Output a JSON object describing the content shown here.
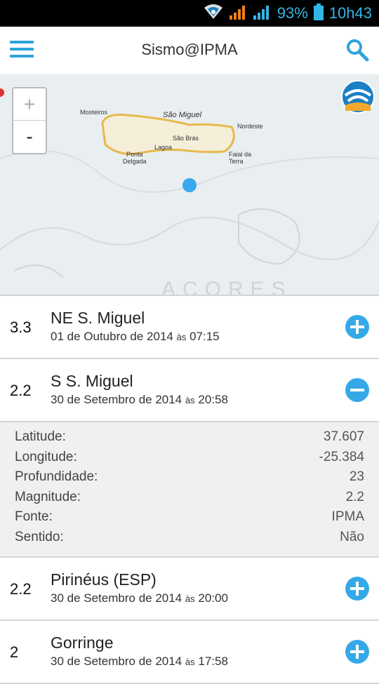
{
  "status_bar": {
    "battery": "93%",
    "time": "10h43"
  },
  "app_bar": {
    "title": "Sismo@IPMA"
  },
  "map": {
    "zoom_in": "+",
    "zoom_out": "-",
    "island": "São Miguel",
    "places": [
      "Mosteiros",
      "São Brás",
      "Nordeste",
      "Lagoa",
      "Ponta",
      "Delgada",
      "Faial da",
      "Terra"
    ],
    "region": "AÇORES"
  },
  "quakes": [
    {
      "magnitude": "3.3",
      "place": "NE S. Miguel",
      "date": "01 de Outubro de 2014",
      "as": "às",
      "time": "07:15",
      "expanded": false
    },
    {
      "magnitude": "2.2",
      "place": "S S. Miguel",
      "date": "30 de Setembro de 2014",
      "as": "às",
      "time": "20:58",
      "expanded": true
    },
    {
      "magnitude": "2.2",
      "place": "Pirinéus (ESP)",
      "date": "30 de Setembro de 2014",
      "as": "às",
      "time": "20:00",
      "expanded": false
    },
    {
      "magnitude": "2",
      "place": "Gorringe",
      "date": "30 de Setembro de 2014",
      "as": "às",
      "time": "17:58",
      "expanded": false
    }
  ],
  "details": [
    {
      "label": "Latitude:",
      "value": "37.607"
    },
    {
      "label": "Longitude:",
      "value": "-25.384"
    },
    {
      "label": "Profundidade:",
      "value": "23"
    },
    {
      "label": "Magnitude:",
      "value": "2.2"
    },
    {
      "label": "Fonte:",
      "value": "IPMA"
    },
    {
      "label": "Sentido:",
      "value": "Não"
    }
  ],
  "colors": {
    "accent": "#35a9e8",
    "status_bg": "#000000"
  }
}
